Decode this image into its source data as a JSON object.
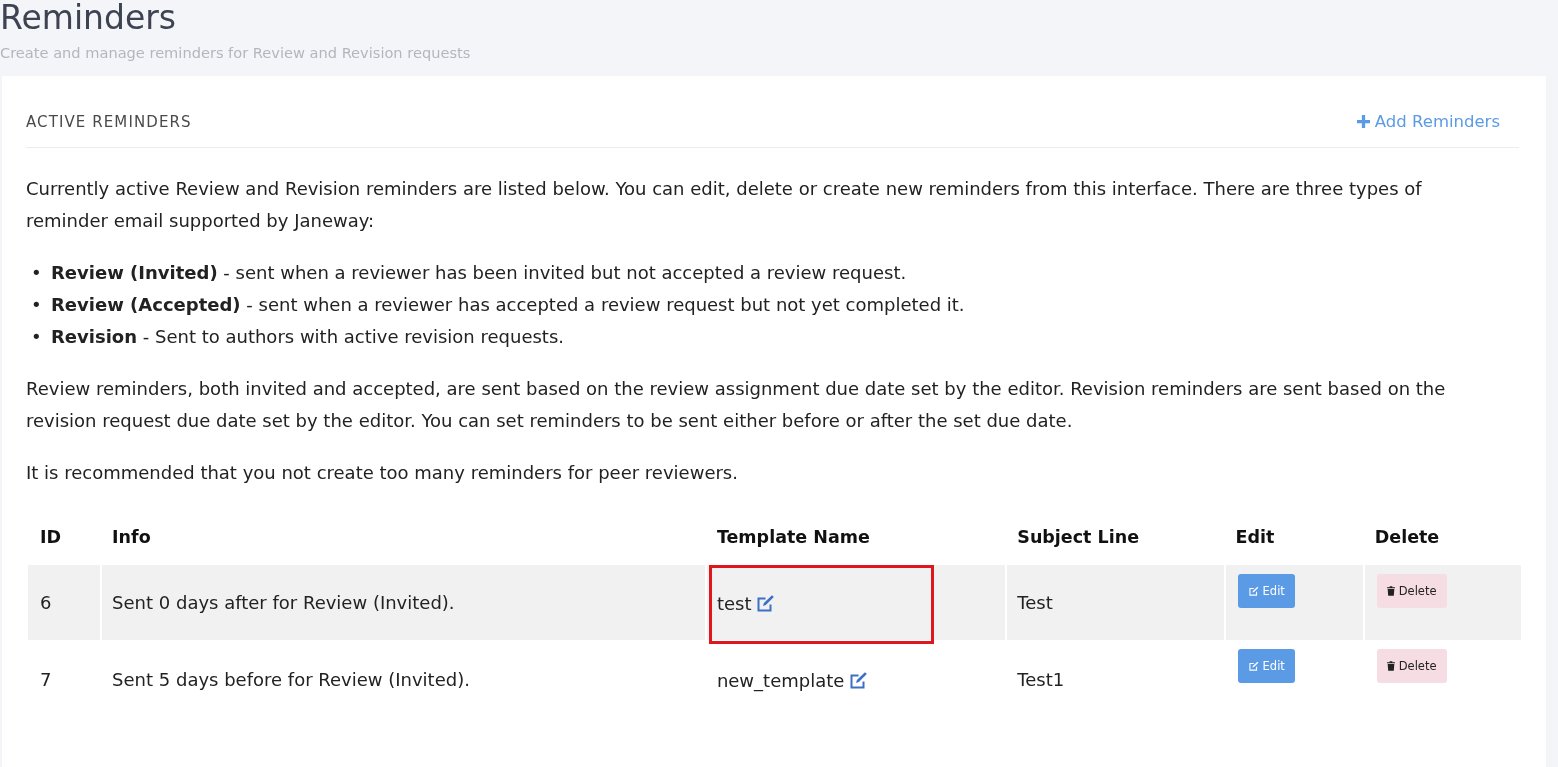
{
  "page": {
    "title": "Reminders",
    "subtitle": "Create and manage reminders for Review and Revision requests"
  },
  "panel": {
    "title": "ACTIVE REMINDERS",
    "add_link": "Add Reminders"
  },
  "intro": "Currently active Review and Revision reminders are listed below. You can edit, delete or create new reminders from this interface. There are three types of reminder email supported by Janeway:",
  "types": [
    {
      "marker": "•",
      "text": "**Review (Invited)** - sent when a reviewer has been invited but not accepted a review request."
    },
    {
      "marker": "•",
      "text": "**Review (Accepted)** - sent when a reviewer has accepted a review request but not yet completed it."
    },
    {
      "marker": "•",
      "text": "**Revision** - Sent to authors with active revision requests."
    }
  ],
  "notes": [
    "Review reminders, both invited and accepted, are sent based on the review assignment due date set by the editor. Revision reminders are sent based on the revision request due date set by the editor. You can set reminders to be sent either before or after the set due date.",
    "It is recommended that you not create too many reminders for peer reviewers."
  ],
  "table": {
    "columns": [
      "ID",
      "Info",
      "Template Name",
      "Subject Line",
      "Edit",
      "Delete"
    ],
    "rows": [
      {
        "id": "6",
        "info": "Sent 0 days after for Review (Invited).",
        "template_name": "test",
        "subject_line": "Test",
        "edit_button": "Edit",
        "delete_button": "Delete",
        "highlighted": true
      },
      {
        "id": "7",
        "info": "Sent 5 days before for Review (Invited).",
        "template_name": "new_template",
        "subject_line": "Test1",
        "edit_button": "Edit",
        "delete_button": "Delete",
        "highlighted": false
      }
    ]
  }
}
